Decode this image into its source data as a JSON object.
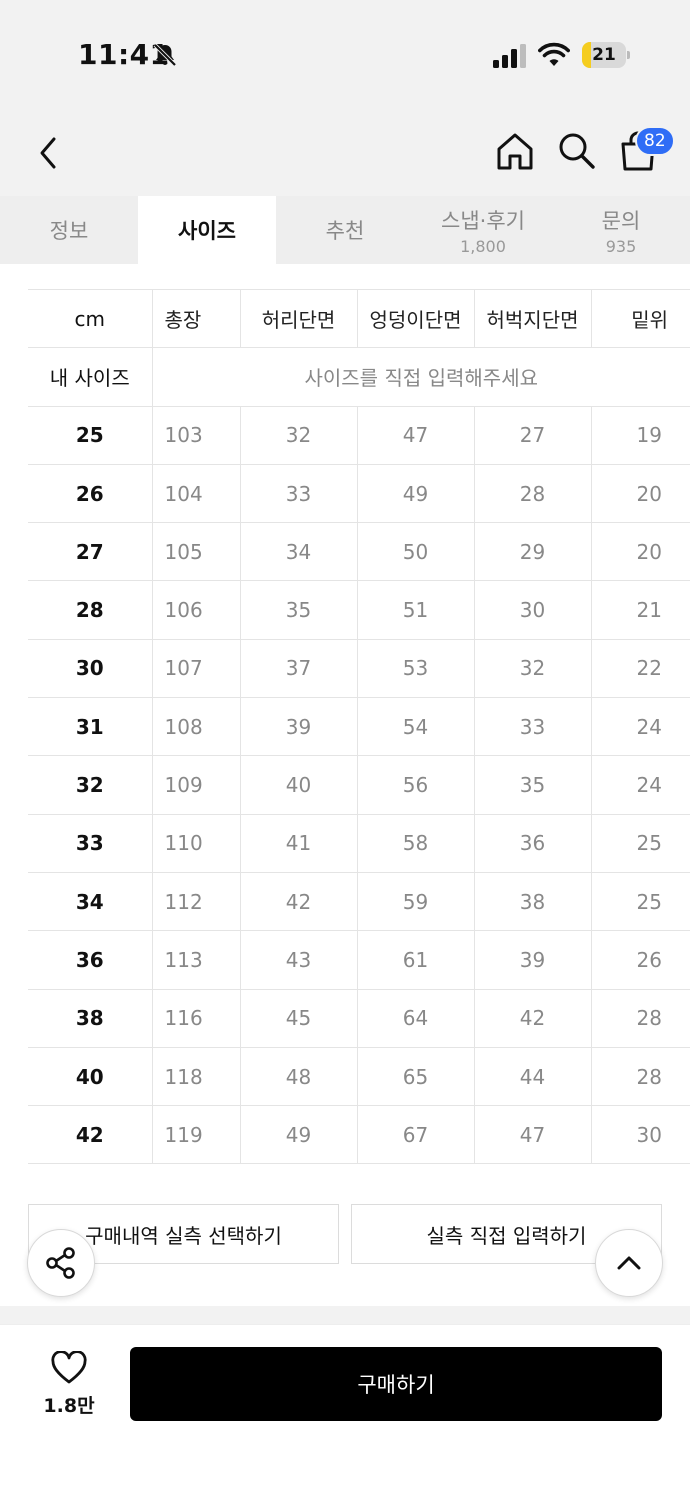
{
  "status_bar": {
    "time": "11:41",
    "battery": "21",
    "battery_level": 0.21
  },
  "nav": {
    "cart_badge": "82"
  },
  "tabs": [
    {
      "label": "정보",
      "count": ""
    },
    {
      "label": "사이즈",
      "count": ""
    },
    {
      "label": "추천",
      "count": ""
    },
    {
      "label": "스냅·후기",
      "count": "1,800"
    },
    {
      "label": "문의",
      "count": "935"
    }
  ],
  "size_table": {
    "unit": "cm",
    "columns": [
      "총장",
      "허리단면",
      "엉덩이단면",
      "허벅지단면",
      "밑위"
    ],
    "my_size_label": "내 사이즈",
    "my_size_placeholder": "사이즈를 직접 입력해주세요",
    "rows": [
      {
        "size": "25",
        "values": [
          "103",
          "32",
          "47",
          "27",
          "19"
        ]
      },
      {
        "size": "26",
        "values": [
          "104",
          "33",
          "49",
          "28",
          "20"
        ]
      },
      {
        "size": "27",
        "values": [
          "105",
          "34",
          "50",
          "29",
          "20"
        ]
      },
      {
        "size": "28",
        "values": [
          "106",
          "35",
          "51",
          "30",
          "21"
        ]
      },
      {
        "size": "30",
        "values": [
          "107",
          "37",
          "53",
          "32",
          "22"
        ]
      },
      {
        "size": "31",
        "values": [
          "108",
          "39",
          "54",
          "33",
          "24"
        ]
      },
      {
        "size": "32",
        "values": [
          "109",
          "40",
          "56",
          "35",
          "24"
        ]
      },
      {
        "size": "33",
        "values": [
          "110",
          "41",
          "58",
          "36",
          "25"
        ]
      },
      {
        "size": "34",
        "values": [
          "112",
          "42",
          "59",
          "38",
          "25"
        ]
      },
      {
        "size": "36",
        "values": [
          "113",
          "43",
          "61",
          "39",
          "26"
        ]
      },
      {
        "size": "38",
        "values": [
          "116",
          "45",
          "64",
          "42",
          "28"
        ]
      },
      {
        "size": "40",
        "values": [
          "118",
          "48",
          "65",
          "44",
          "28"
        ]
      },
      {
        "size": "42",
        "values": [
          "119",
          "49",
          "67",
          "47",
          "30"
        ]
      }
    ]
  },
  "actions": {
    "purchase_history_button": "구매내역 실측 선택하기",
    "direct_input_button": "실측 직접 입력하기"
  },
  "bottom_bar": {
    "like_count": "1.8만",
    "buy_button": "구매하기"
  },
  "colors": {
    "badge": "#2f6df6",
    "battery_fill": "#f5cd1f",
    "buy_button": "#000000"
  }
}
